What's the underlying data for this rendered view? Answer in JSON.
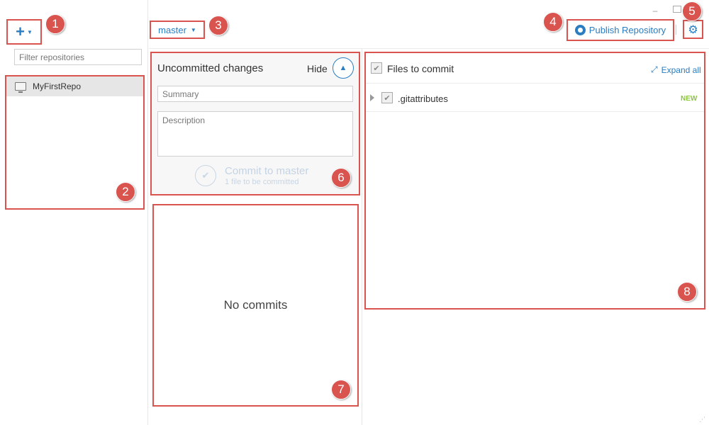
{
  "window": {
    "minimize_glyph": "–"
  },
  "sidebar": {
    "add_glyph": "+",
    "filter_placeholder": "Filter repositories",
    "repos": [
      {
        "label": "MyFirstRepo",
        "icon": "monitor-icon",
        "selected": true
      }
    ]
  },
  "toolbar": {
    "branch_label": "master",
    "publish_label": "Publish Repository",
    "publish_icon": "github-icon",
    "settings_icon": "gear-icon"
  },
  "commit": {
    "title": "Uncommitted changes",
    "hide_label": "Hide",
    "summary_placeholder": "Summary",
    "description_placeholder": "Description",
    "commit_label": "Commit to master",
    "commit_sub": "1 file to be committed"
  },
  "history": {
    "empty_text": "No commits"
  },
  "files": {
    "header_label": "Files to commit",
    "expand_all_label": "Expand all",
    "items": [
      {
        "name": ".gitattributes",
        "status": "NEW",
        "checked": true
      }
    ]
  },
  "markers": [
    "1",
    "2",
    "3",
    "4",
    "5",
    "6",
    "7",
    "8"
  ],
  "colors": {
    "accent": "#2b7dc2",
    "callout": "#d9534f",
    "new_badge": "#8cc63f"
  }
}
